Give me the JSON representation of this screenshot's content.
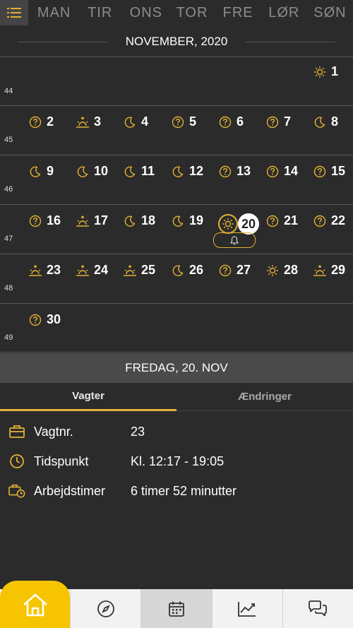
{
  "weekdays": [
    "MAN",
    "TIR",
    "ONS",
    "TOR",
    "FRE",
    "LØR",
    "SØN"
  ],
  "month_title": "NOVEMBER, 2020",
  "weeks": [
    {
      "num": "44",
      "days": [
        {
          "col": 6,
          "d": "1",
          "icon": "sun-icon"
        }
      ]
    },
    {
      "num": "45",
      "days": [
        {
          "col": 0,
          "d": "2",
          "icon": "question-icon"
        },
        {
          "col": 1,
          "d": "3",
          "icon": "sunrise-icon"
        },
        {
          "col": 2,
          "d": "4",
          "icon": "moon-icon"
        },
        {
          "col": 3,
          "d": "5",
          "icon": "question-icon"
        },
        {
          "col": 4,
          "d": "6",
          "icon": "question-icon"
        },
        {
          "col": 5,
          "d": "7",
          "icon": "question-icon"
        },
        {
          "col": 6,
          "d": "8",
          "icon": "moon-icon"
        }
      ]
    },
    {
      "num": "46",
      "days": [
        {
          "col": 0,
          "d": "9",
          "icon": "moon-icon"
        },
        {
          "col": 1,
          "d": "10",
          "icon": "moon-icon"
        },
        {
          "col": 2,
          "d": "11",
          "icon": "moon-icon"
        },
        {
          "col": 3,
          "d": "12",
          "icon": "moon-icon"
        },
        {
          "col": 4,
          "d": "13",
          "icon": "question-icon"
        },
        {
          "col": 5,
          "d": "14",
          "icon": "question-icon"
        },
        {
          "col": 6,
          "d": "15",
          "icon": "question-icon"
        }
      ]
    },
    {
      "num": "47",
      "days": [
        {
          "col": 0,
          "d": "16",
          "icon": "question-icon"
        },
        {
          "col": 1,
          "d": "17",
          "icon": "sunrise-icon"
        },
        {
          "col": 2,
          "d": "18",
          "icon": "moon-icon"
        },
        {
          "col": 3,
          "d": "19",
          "icon": "moon-icon"
        },
        {
          "col": 4,
          "d": "20",
          "icon": "sun-icon",
          "selected": true
        },
        {
          "col": 5,
          "d": "21",
          "icon": "question-icon"
        },
        {
          "col": 6,
          "d": "22",
          "icon": "question-icon"
        }
      ]
    },
    {
      "num": "48",
      "days": [
        {
          "col": 0,
          "d": "23",
          "icon": "sunrise-icon"
        },
        {
          "col": 1,
          "d": "24",
          "icon": "sunrise-icon"
        },
        {
          "col": 2,
          "d": "25",
          "icon": "sunrise-icon"
        },
        {
          "col": 3,
          "d": "26",
          "icon": "moon-icon"
        },
        {
          "col": 4,
          "d": "27",
          "icon": "question-icon"
        },
        {
          "col": 5,
          "d": "28",
          "icon": "sun-icon"
        },
        {
          "col": 6,
          "d": "29",
          "icon": "sunrise-icon"
        }
      ]
    },
    {
      "num": "49",
      "days": [
        {
          "col": 0,
          "d": "30",
          "icon": "question-icon"
        }
      ]
    }
  ],
  "selected_day_title": "FREDAG, 20. NOV",
  "tabs": {
    "shifts": "Vagter",
    "changes": "Ændringer"
  },
  "details": [
    {
      "icon": "briefcase-icon",
      "label": "Vagtnr.",
      "value": "23"
    },
    {
      "icon": "clock-icon",
      "label": "Tidspunkt",
      "value": "Kl. 12:17 - 19:05"
    },
    {
      "icon": "briefcase-clock-icon",
      "label": "Arbejdstimer",
      "value": "6 timer 52 minutter"
    }
  ],
  "nav": [
    "home-icon",
    "compass-icon",
    "calendar-icon",
    "chart-icon",
    "chat-icon"
  ],
  "colors": {
    "accent": "#e3b133",
    "background": "#2b2b2b",
    "nav": "#f2f2f2",
    "home": "#f6c400"
  }
}
